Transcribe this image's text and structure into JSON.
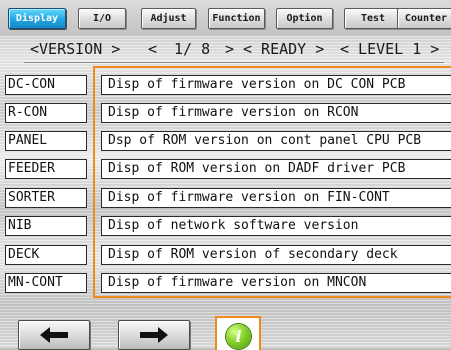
{
  "tabs": [
    {
      "label": "Display",
      "active": true
    },
    {
      "label": "I/O",
      "active": false
    },
    {
      "label": "Adjust",
      "active": false
    },
    {
      "label": "Function",
      "active": false
    },
    {
      "label": "Option",
      "active": false
    },
    {
      "label": "Test",
      "active": false
    },
    {
      "label": "Counter",
      "active": false
    }
  ],
  "header": {
    "category": "<VERSION >",
    "prev_arrow": "<",
    "page": "1/ 8",
    "next_arrow": ">",
    "status": "< READY  >",
    "level": "< LEVEL 1 >"
  },
  "items": [
    {
      "label": "DC-CON",
      "description": "Disp of firmware version on DC CON PCB"
    },
    {
      "label": "R-CON",
      "description": "Disp of firmware version on RCON"
    },
    {
      "label": "PANEL",
      "description": "Dsp of ROM version on cont panel CPU PCB"
    },
    {
      "label": "FEEDER",
      "description": "Disp of ROM version on DADF driver PCB"
    },
    {
      "label": "SORTER",
      "description": "Disp of firmware version on FIN-CONT"
    },
    {
      "label": "NIB",
      "description": "Disp of network software version"
    },
    {
      "label": "DECK",
      "description": "Disp of ROM version of secondary deck"
    },
    {
      "label": "MN-CONT",
      "description": "Disp of firmware version on MNCON"
    }
  ],
  "footer": {
    "prev_icon": "left-arrow-icon",
    "next_icon": "right-arrow-icon",
    "info_icon": "info-icon",
    "info_glyph": "i"
  },
  "colors": {
    "active_tab": "#22a4e3",
    "selection_border": "#f08a1c",
    "info_green": "#86d02a"
  }
}
